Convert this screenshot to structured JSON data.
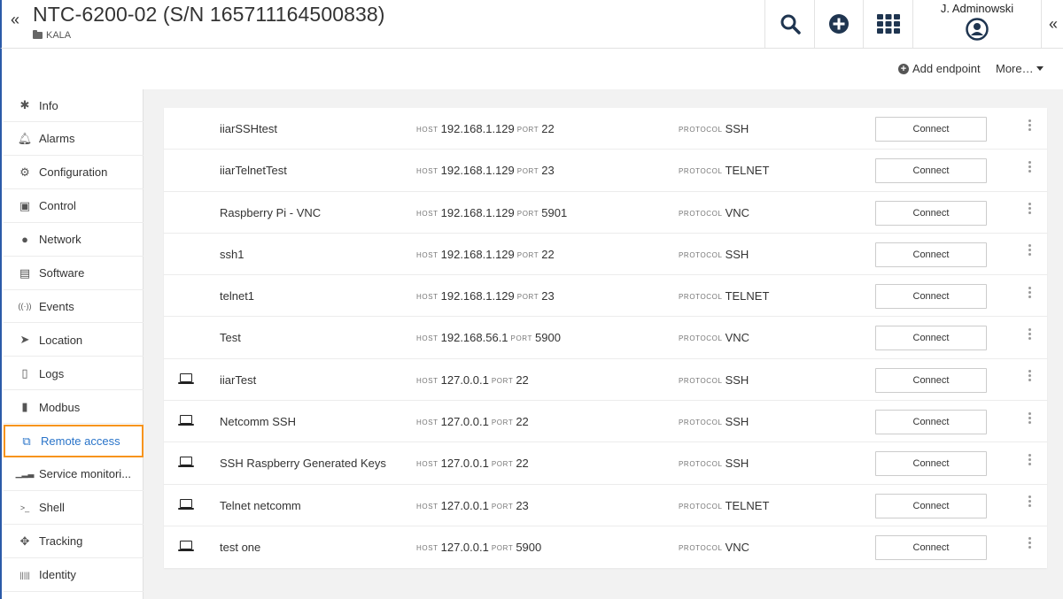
{
  "header": {
    "title": "NTC-6200-02 (S/N 165711164500838)",
    "breadcrumb": "KALA",
    "user": "J. Adminowski"
  },
  "actionbar": {
    "add_endpoint": "Add endpoint",
    "more": "More…"
  },
  "sidebar": {
    "items": [
      {
        "label": "Info",
        "icon": "asterisk-icon"
      },
      {
        "label": "Alarms",
        "icon": "bell-icon"
      },
      {
        "label": "Configuration",
        "icon": "cogs-icon"
      },
      {
        "label": "Control",
        "icon": "control-icon"
      },
      {
        "label": "Network",
        "icon": "globe-icon"
      },
      {
        "label": "Software",
        "icon": "floppy-icon"
      },
      {
        "label": "Events",
        "icon": "broadcast-icon"
      },
      {
        "label": "Location",
        "icon": "location-arrow-icon"
      },
      {
        "label": "Logs",
        "icon": "document-icon"
      },
      {
        "label": "Modbus",
        "icon": "chip-icon"
      },
      {
        "label": "Remote access",
        "icon": "remote-access-icon",
        "active": true
      },
      {
        "label": "Service monitori...",
        "icon": "signal-bars-icon"
      },
      {
        "label": "Shell",
        "icon": "terminal-icon"
      },
      {
        "label": "Tracking",
        "icon": "crosshair-icon"
      },
      {
        "label": "Identity",
        "icon": "barcode-icon"
      }
    ]
  },
  "table": {
    "host_label": "HOST",
    "port_label": "PORT",
    "protocol_label": "PROTOCOL",
    "connect_label": "Connect",
    "rows": [
      {
        "icon": "globe",
        "name": "iiarSSHtest",
        "host": "192.168.1.129",
        "port": "22",
        "protocol": "SSH"
      },
      {
        "icon": "globe",
        "name": "iiarTelnetTest",
        "host": "192.168.1.129",
        "port": "23",
        "protocol": "TELNET"
      },
      {
        "icon": "globe",
        "name": "Raspberry Pi - VNC",
        "host": "192.168.1.129",
        "port": "5901",
        "protocol": "VNC"
      },
      {
        "icon": "globe",
        "name": "ssh1",
        "host": "192.168.1.129",
        "port": "22",
        "protocol": "SSH"
      },
      {
        "icon": "globe",
        "name": "telnet1",
        "host": "192.168.1.129",
        "port": "23",
        "protocol": "TELNET"
      },
      {
        "icon": "globe",
        "name": "Test",
        "host": "192.168.56.1",
        "port": "5900",
        "protocol": "VNC"
      },
      {
        "icon": "laptop",
        "name": "iiarTest",
        "host": "127.0.0.1",
        "port": "22",
        "protocol": "SSH"
      },
      {
        "icon": "laptop",
        "name": "Netcomm SSH",
        "host": "127.0.0.1",
        "port": "22",
        "protocol": "SSH"
      },
      {
        "icon": "laptop",
        "name": "SSH Raspberry Generated Keys",
        "host": "127.0.0.1",
        "port": "22",
        "protocol": "SSH"
      },
      {
        "icon": "laptop",
        "name": "Telnet netcomm",
        "host": "127.0.0.1",
        "port": "23",
        "protocol": "TELNET"
      },
      {
        "icon": "laptop",
        "name": "test one",
        "host": "127.0.0.1",
        "port": "5900",
        "protocol": "VNC"
      }
    ]
  },
  "colors": {
    "accent": "#2a74c9",
    "active_border": "#f7941d",
    "left_edge": "#2b5aa8"
  }
}
